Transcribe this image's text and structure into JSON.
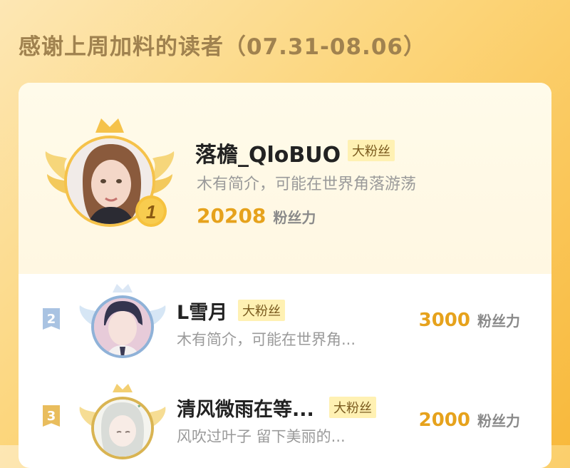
{
  "page": {
    "title": "感谢上周加料的读者（07.31-08.06）"
  },
  "colors": {
    "accent": "#e6a21c",
    "badge_bg": "#fff1b3",
    "rank2": "#a9c3e2",
    "rank3": "#e9bd5d"
  },
  "readers": [
    {
      "rank": "1",
      "name": "落檐_QloBUO",
      "badge": "大粉丝",
      "bio": "木有简介，可能在世界角落游荡",
      "score": "20208",
      "score_unit": "粉丝力"
    },
    {
      "rank": "2",
      "name": "L雪月",
      "badge": "大粉丝",
      "bio": "木有简介，可能在世界角...",
      "score": "3000",
      "score_unit": "粉丝力"
    },
    {
      "rank": "3",
      "name": "清风微雨在等...",
      "badge": "大粉丝",
      "bio": "风吹过叶子 留下美丽的...",
      "score": "2000",
      "score_unit": "粉丝力"
    }
  ]
}
